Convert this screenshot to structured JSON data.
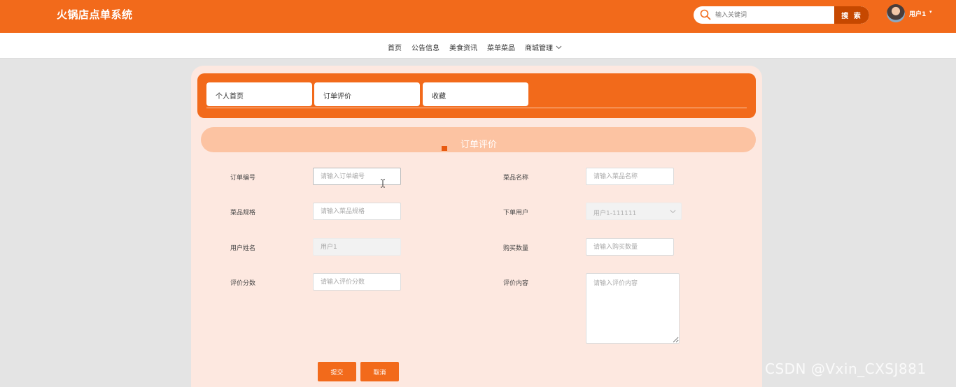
{
  "header": {
    "title": "火锅店点单系统",
    "search_placeholder": "输入关键词",
    "search_button": "搜 索",
    "user_name": "用户1",
    "user_caret": "▾",
    "brand_color": "#f26a1b"
  },
  "nav": {
    "items": [
      "首页",
      "公告信息",
      "美食资讯",
      "菜单菜品",
      "商城管理"
    ],
    "dropdown_chevron": "chevron-down-icon"
  },
  "tabs": [
    "个人首页",
    "订单评价",
    "收藏"
  ],
  "section": {
    "title": "订单评价"
  },
  "form": {
    "order_no": {
      "label": "订单编号",
      "placeholder": "请输入订单编号"
    },
    "dish_name": {
      "label": "菜品名称",
      "placeholder": "请输入菜品名称"
    },
    "dish_spec": {
      "label": "菜品规格",
      "placeholder": "请输入菜品规格"
    },
    "order_user": {
      "label": "下单用户",
      "value": "用户1-111111"
    },
    "user_name": {
      "label": "用户姓名",
      "placeholder": "用户1"
    },
    "quantity": {
      "label": "购买数量",
      "placeholder": "请输入购买数量"
    },
    "score": {
      "label": "评价分数",
      "placeholder": "请输入评价分数"
    },
    "content": {
      "label": "评价内容",
      "placeholder": "请输入评价内容"
    }
  },
  "buttons": {
    "submit": "提交",
    "cancel": "取消"
  },
  "watermark": "CSDN @Vxin_CXSJ881"
}
